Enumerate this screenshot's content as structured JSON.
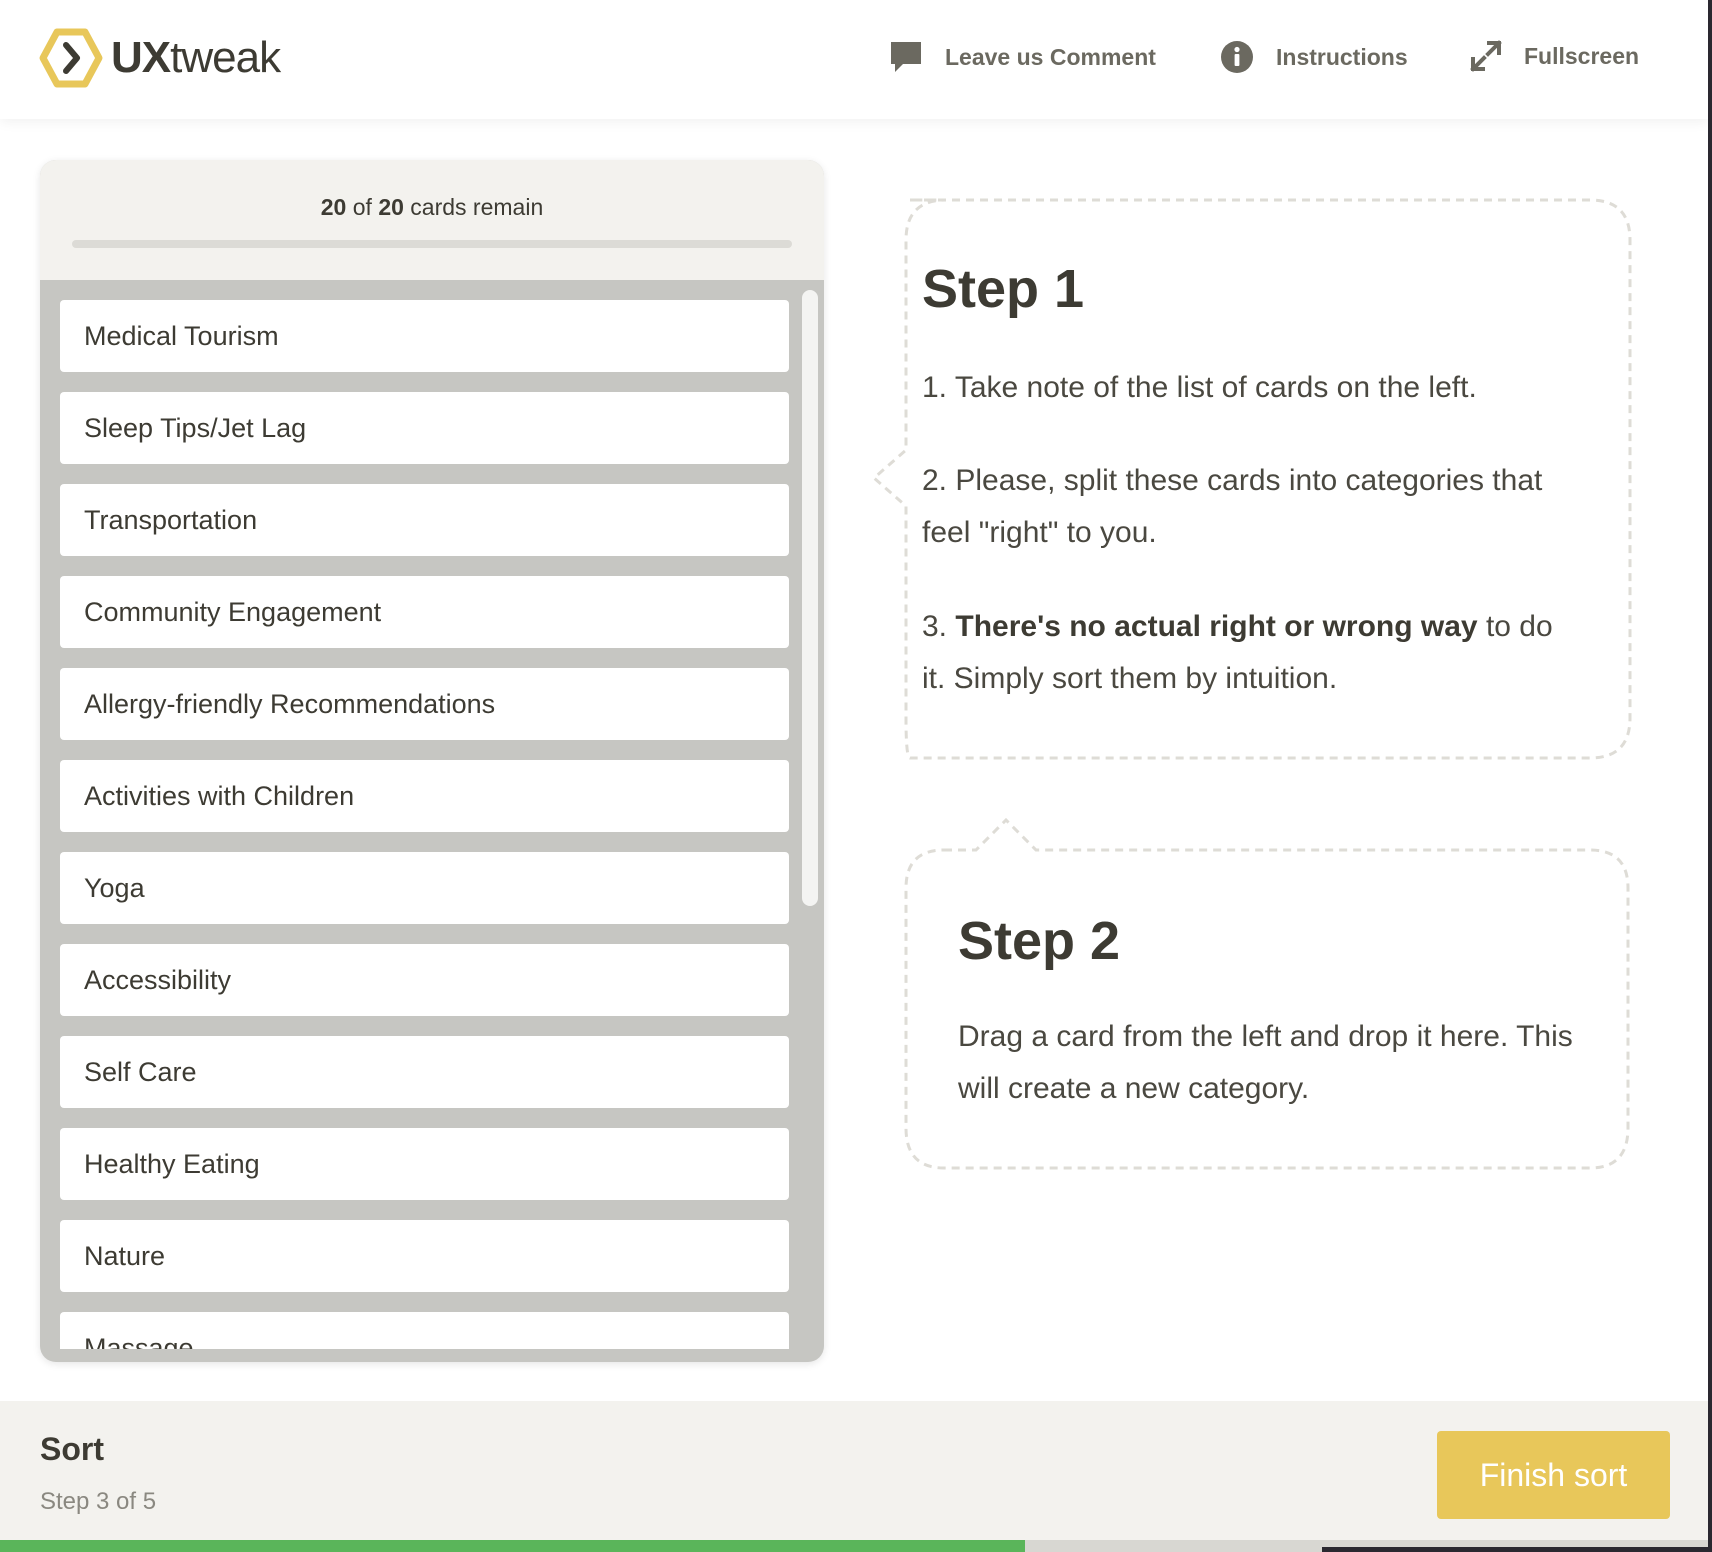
{
  "colors": {
    "accent": "#e8c75a",
    "progress": "#5ab55a",
    "panel_bg": "#c6c6c2",
    "text": "#3d3b33"
  },
  "header": {
    "logo": {
      "brand_bold": "UX",
      "brand_light": "tweak"
    },
    "nav": [
      {
        "label": "Leave us Comment",
        "icon": "comment-icon"
      },
      {
        "label": "Instructions",
        "icon": "info-icon"
      },
      {
        "label": "Fullscreen",
        "icon": "fullscreen-icon"
      }
    ]
  },
  "cards_panel": {
    "remaining": "20",
    "total": "20",
    "of_label": "of",
    "suffix": "cards remain",
    "progress_fraction": 0,
    "cards": [
      "Medical Tourism",
      "Sleep Tips/Jet Lag",
      "Transportation",
      "Community Engagement",
      "Allergy-friendly Recommendations",
      "Activities with Children",
      "Yoga",
      "Accessibility",
      "Self Care",
      "Healthy Eating",
      "Nature",
      "Massage"
    ]
  },
  "step1": {
    "title": "Step 1",
    "item1": "1. Take note of the list of cards on the left.",
    "item2": "2. Please, split these cards into categories that feel \"right\" to you.",
    "item3_prefix": "3.",
    "item3_bold": "There's no actual right or wrong way",
    "item3_suffix": "to do it. Simply sort them by intuition."
  },
  "step2": {
    "title": "Step 2",
    "text": "Drag a card from the left and drop it here. This will create a new category."
  },
  "footer": {
    "title": "Sort",
    "step": "Step 3 of 5",
    "finish_label": "Finish sort",
    "progress_fraction": 0.6
  }
}
